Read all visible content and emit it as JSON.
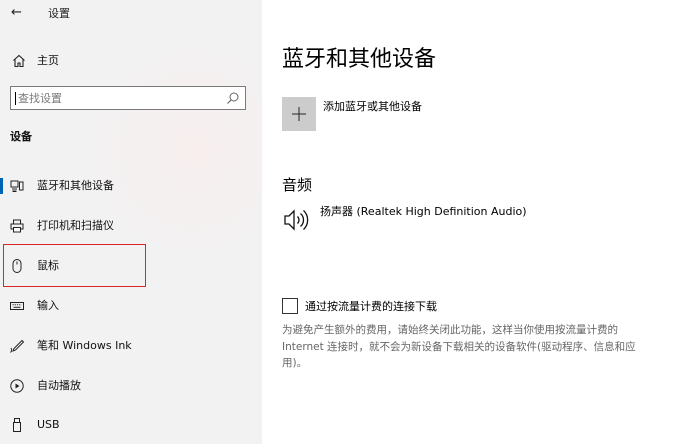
{
  "window": {
    "title": "设置"
  },
  "sidebar": {
    "home_label": "主页",
    "search": {
      "placeholder": "查找设置"
    },
    "section_heading": "设备",
    "items": [
      {
        "label": "蓝牙和其他设备",
        "icon": "bluetooth-devices-icon"
      },
      {
        "label": "打印机和扫描仪",
        "icon": "printer-icon"
      },
      {
        "label": "鼠标",
        "icon": "mouse-icon"
      },
      {
        "label": "输入",
        "icon": "keyboard-icon"
      },
      {
        "label": "笔和 Windows Ink",
        "icon": "pen-icon"
      },
      {
        "label": "自动播放",
        "icon": "autoplay-icon"
      },
      {
        "label": "USB",
        "icon": "usb-icon"
      }
    ]
  },
  "main": {
    "title": "蓝牙和其他设备",
    "add_device_label": "添加蓝牙或其他设备",
    "audio_heading": "音频",
    "audio_device": "扬声器 (Realtek High Definition Audio)",
    "metered_label": "通过按流量计费的连接下载",
    "metered_description": "为避免产生额外的费用，请始终关闭此功能，这样当你使用按流量计费的Internet 连接时，就不会为新设备下载相关的设备软件(驱动程序、信息和应用)。"
  },
  "colors": {
    "accent": "#0063b1",
    "highlight": "#d9262b",
    "sidebar_bg": "#f2f2f2"
  }
}
